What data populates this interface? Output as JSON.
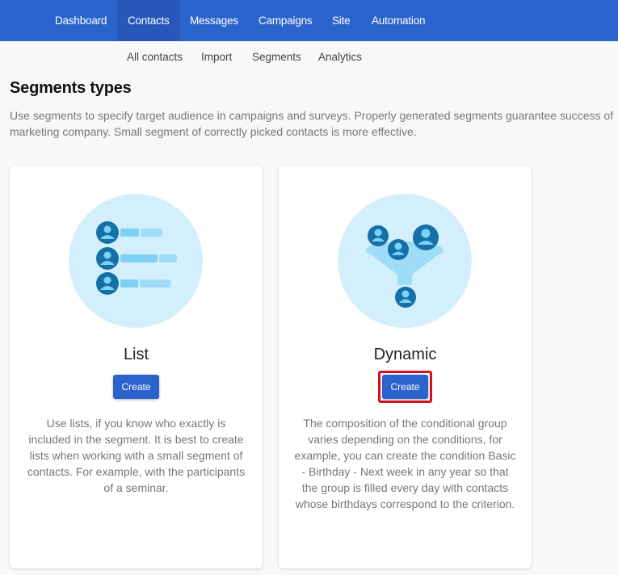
{
  "topnav": {
    "items": [
      {
        "label": "Dashboard",
        "active": false
      },
      {
        "label": "Contacts",
        "active": true
      },
      {
        "label": "Messages",
        "active": false
      },
      {
        "label": "Campaigns",
        "active": false
      },
      {
        "label": "Site",
        "active": false
      },
      {
        "label": "Automation",
        "active": false
      }
    ]
  },
  "subnav": {
    "items": [
      "All contacts",
      "Import",
      "Segments",
      "Analytics"
    ]
  },
  "page": {
    "title": "Segments types",
    "intro": "Use segments to specify target audience in campaigns and surveys. Properly generated segments guarantee success of marketing company. Small segment of correctly picked contacts is more effective."
  },
  "cards": [
    {
      "title": "List",
      "icon": "contact-list-icon",
      "button_label": "Create",
      "highlighted": false,
      "description": "Use lists, if you know who exactly is included in the segment. It is best to create lists when working with a small segment of contacts. For example, with the participants of a seminar."
    },
    {
      "title": "Dynamic",
      "icon": "contact-funnel-icon",
      "button_label": "Create",
      "highlighted": true,
      "description": "The composition of the conditional group varies depending on the conditions, for example, you can create the condition Basic - Birthday - Next week in any year so that the group is filled every day with contacts whose birthdays correspond to the criterion."
    }
  ],
  "colors": {
    "brand": "#2b63cc",
    "highlight": "#d80f1f",
    "icon_dark": "#1471a8",
    "icon_light": "#7fd0f5",
    "icon_bg": "#d4effc"
  }
}
